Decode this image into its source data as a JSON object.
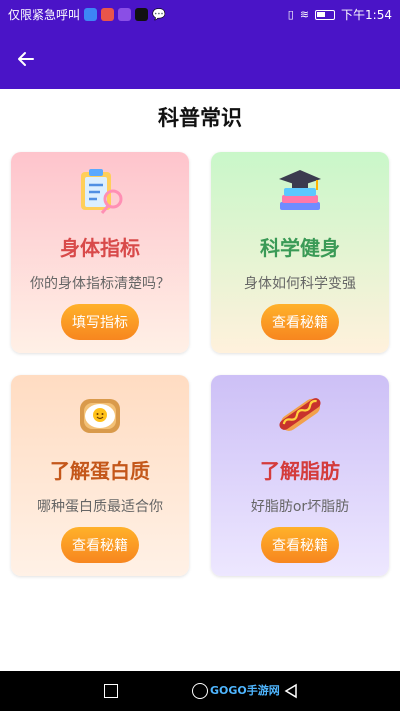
{
  "status_bar": {
    "notice": "仅限紧急呼叫",
    "time": "下午1:54",
    "app_icon_colors": [
      "#3d86f5",
      "#e9554a",
      "#8a4ee6",
      "#111111",
      "#ffffff"
    ]
  },
  "app_bar": {
    "back_icon": "arrow-left-icon"
  },
  "page": {
    "title": "科普常识"
  },
  "cards": [
    {
      "icon": "clipboard-icon",
      "title": "身体指标",
      "title_color": "#d84a4a",
      "subtitle": "你的身体指标清楚吗？",
      "button": "填写指标"
    },
    {
      "icon": "books-cap-icon",
      "title": "科学健身",
      "title_color": "#3a9a56",
      "subtitle": "身体如何科学变强",
      "button": "查看秘籍"
    },
    {
      "icon": "egg-toast-icon",
      "title": "了解蛋白质",
      "title_color": "#c4571a",
      "subtitle": "哪种蛋白质最适合你",
      "button": "查看秘籍"
    },
    {
      "icon": "hotdog-icon",
      "title": "了解脂肪",
      "title_color": "#d43b3b",
      "subtitle": "好脂肪or坏脂肪",
      "button": "查看秘籍"
    }
  ],
  "nav_bar": {
    "watermark": "GOGO手游网"
  },
  "colors": {
    "app_bar": "#4a14c7",
    "button_orange": "#f7861f"
  }
}
